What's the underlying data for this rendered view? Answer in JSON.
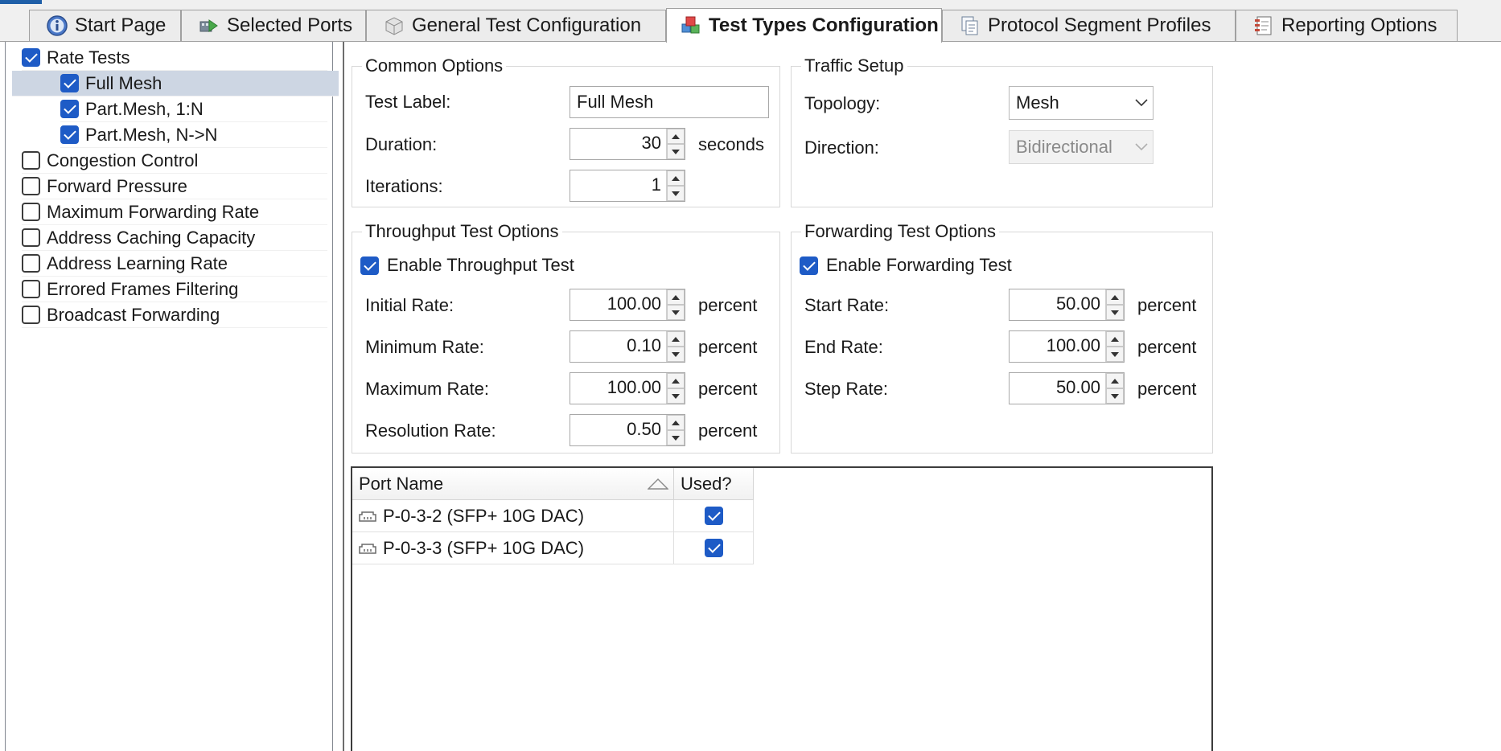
{
  "tabs": [
    {
      "label": "Start Page",
      "icon": "info-icon"
    },
    {
      "label": "Selected Ports",
      "icon": "ports-arrow-icon"
    },
    {
      "label": "General Test Configuration",
      "icon": "config-box-icon"
    },
    {
      "label": "Test Types Configuration",
      "icon": "test-types-cubes-icon",
      "active": true
    },
    {
      "label": "Protocol Segment Profiles",
      "icon": "documents-icon"
    },
    {
      "label": "Reporting Options",
      "icon": "report-icon"
    }
  ],
  "tree": [
    {
      "label": "Rate Tests",
      "checked": true
    },
    {
      "label": "Full Mesh",
      "checked": true,
      "selected": true
    },
    {
      "label": "Part.Mesh, 1:N",
      "checked": true
    },
    {
      "label": "Part.Mesh, N->N",
      "checked": true
    },
    {
      "label": "Congestion Control",
      "checked": false
    },
    {
      "label": "Forward Pressure",
      "checked": false
    },
    {
      "label": "Maximum Forwarding Rate",
      "checked": false
    },
    {
      "label": "Address Caching Capacity",
      "checked": false
    },
    {
      "label": "Address Learning Rate",
      "checked": false
    },
    {
      "label": "Errored Frames Filtering",
      "checked": false
    },
    {
      "label": "Broadcast Forwarding",
      "checked": false
    }
  ],
  "common": {
    "title": "Common Options",
    "test_label_label": "Test Label:",
    "test_label_value": "Full Mesh",
    "duration_label": "Duration:",
    "duration_value": "30",
    "duration_unit": "seconds",
    "iterations_label": "Iterations:",
    "iterations_value": "1"
  },
  "traffic": {
    "title": "Traffic Setup",
    "topology_label": "Topology:",
    "topology_value": "Mesh",
    "direction_label": "Direction:",
    "direction_value": "Bidirectional"
  },
  "throughput": {
    "title": "Throughput Test Options",
    "enable_label": "Enable Throughput Test",
    "enabled": true,
    "initial_label": "Initial Rate:",
    "initial_value": "100.00",
    "minimum_label": "Minimum Rate:",
    "minimum_value": "0.10",
    "maximum_label": "Maximum Rate:",
    "maximum_value": "100.00",
    "resolution_label": "Resolution Rate:",
    "resolution_value": "0.50",
    "unit": "percent"
  },
  "forwarding": {
    "title": "Forwarding Test Options",
    "enable_label": "Enable Forwarding Test",
    "enabled": true,
    "start_label": "Start Rate:",
    "start_value": "50.00",
    "end_label": "End Rate:",
    "end_value": "100.00",
    "step_label": "Step Rate:",
    "step_value": "50.00",
    "unit": "percent"
  },
  "ports_grid": {
    "columns": [
      "Port Name",
      "Used?"
    ],
    "rows": [
      {
        "name": "P-0-3-2 (SFP+ 10G DAC)",
        "used": true
      },
      {
        "name": "P-0-3-3 (SFP+ 10G DAC)",
        "used": true
      }
    ]
  },
  "colors": {
    "checkbox_blue": "#1e5bc6",
    "selection": "#cdd6e3",
    "tab_strip": "#f0f0f0"
  }
}
